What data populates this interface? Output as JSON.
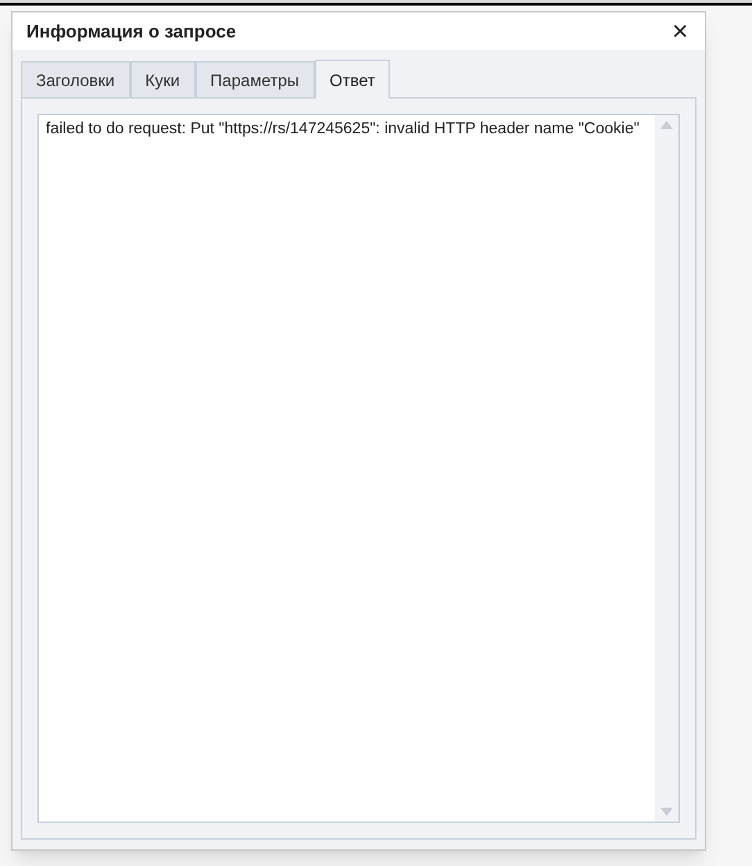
{
  "dialog": {
    "title": "Информация о запросе",
    "close": "×"
  },
  "tabs": [
    {
      "label": "Заголовки",
      "selected": false
    },
    {
      "label": "Куки",
      "selected": false
    },
    {
      "label": "Параметры",
      "selected": false
    },
    {
      "label": "Ответ",
      "selected": true
    }
  ],
  "response": {
    "value": "failed to do request: Put \"https://rs/147245625\": invalid HTTP header name \"Cookie\""
  }
}
